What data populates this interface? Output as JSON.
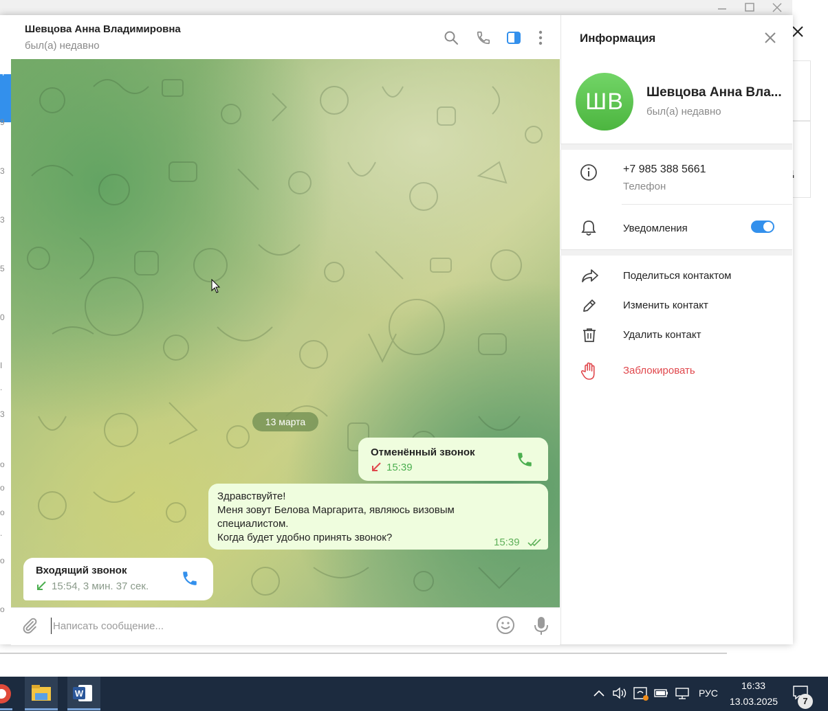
{
  "header": {
    "contact_name": "Шевцова Анна Владимировна",
    "contact_status": "был(а) недавно"
  },
  "chat": {
    "date_separator": "13 марта",
    "messages": [
      {
        "type": "call",
        "direction": "outgoing",
        "title": "Отменённый звонок",
        "time": "15:39"
      },
      {
        "type": "text",
        "direction": "outgoing",
        "lines": [
          "Здравствуйте!",
          "Меня зовут Белова Маргарита, являюсь визовым",
          "специалистом.",
          "Когда будет удобно принять звонок?"
        ],
        "time": "15:39"
      },
      {
        "type": "call",
        "direction": "incoming",
        "title": "Входящий звонок",
        "time": "15:54, 3 мин. 37 сек."
      }
    ]
  },
  "composer": {
    "placeholder": "Написать сообщение..."
  },
  "info": {
    "title": "Информация",
    "avatar_initials": "ШВ",
    "name": "Шевцова Анна Владимировна",
    "status": "был(а) недавно",
    "phone": "+7 985 388 5661",
    "phone_label": "Телефон",
    "notifications_label": "Уведомления",
    "notifications_on": true,
    "actions": {
      "share": "Поделиться контактом",
      "edit": "Изменить контакт",
      "delete": "Удалить контакт",
      "block": "Заблокировать"
    }
  },
  "left_strip_marks": [
    "4",
    "9",
    "3",
    "3",
    "5",
    "0",
    "I",
    ".",
    "3",
    "o",
    "o",
    "o",
    ".",
    "o",
    "o"
  ],
  "taskbar": {
    "language": "РУС",
    "time": "16:33",
    "date": "13.03.2025",
    "notification_count": "7"
  },
  "colors": {
    "accent": "#3390ec",
    "outgoing_bubble": "#effdde",
    "danger": "#e0474c",
    "avatar": "#5cc24f",
    "taskbar": "#1c2b3f"
  }
}
